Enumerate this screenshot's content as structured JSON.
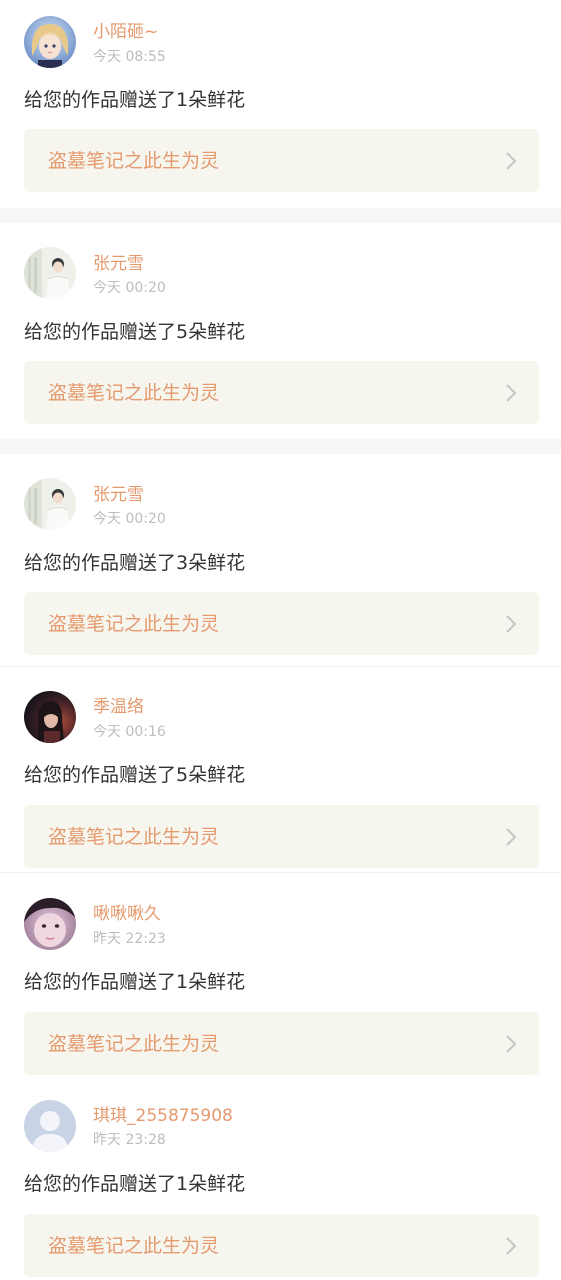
{
  "notifications": [
    {
      "username": "小陌砸~",
      "time": "今天 08:55",
      "message": "给您的作品赠送了1朵鲜花",
      "work_title": "盗墓笔记之此生为灵",
      "avatar_icon": "anime-girl-avatar-icon"
    },
    {
      "username": "张元雪",
      "time": "今天 00:20",
      "message": "给您的作品赠送了5朵鲜花",
      "work_title": "盗墓笔记之此生为灵",
      "avatar_icon": "person-in-white-avatar-icon"
    },
    {
      "username": "张元雪",
      "time": "今天 00:20",
      "message": "给您的作品赠送了3朵鲜花",
      "work_title": "盗墓笔记之此生为灵",
      "avatar_icon": "person-in-white-avatar-icon"
    },
    {
      "username": "季温络",
      "time": "今天 00:16",
      "message": "给您的作品赠送了5朵鲜花",
      "work_title": "盗墓笔记之此生为灵",
      "avatar_icon": "dark-portrait-avatar-icon"
    },
    {
      "username": "啾啾啾久",
      "time": "昨天 22:23",
      "message": "给您的作品赠送了1朵鲜花",
      "work_title": "盗墓笔记之此生为灵",
      "avatar_icon": "selfie-girl-avatar-icon"
    },
    {
      "username": "琪琪_255875908",
      "time": "昨天 23:28",
      "message": "给您的作品赠送了1朵鲜花",
      "work_title": "盗墓笔记之此生为灵",
      "avatar_icon": "default-user-avatar-icon"
    }
  ],
  "colors": {
    "username": "#e59a6e",
    "time": "#bdbdbd",
    "message": "#333333",
    "link_bg": "#f6f6ef",
    "chevron": "#c4c4c4"
  }
}
